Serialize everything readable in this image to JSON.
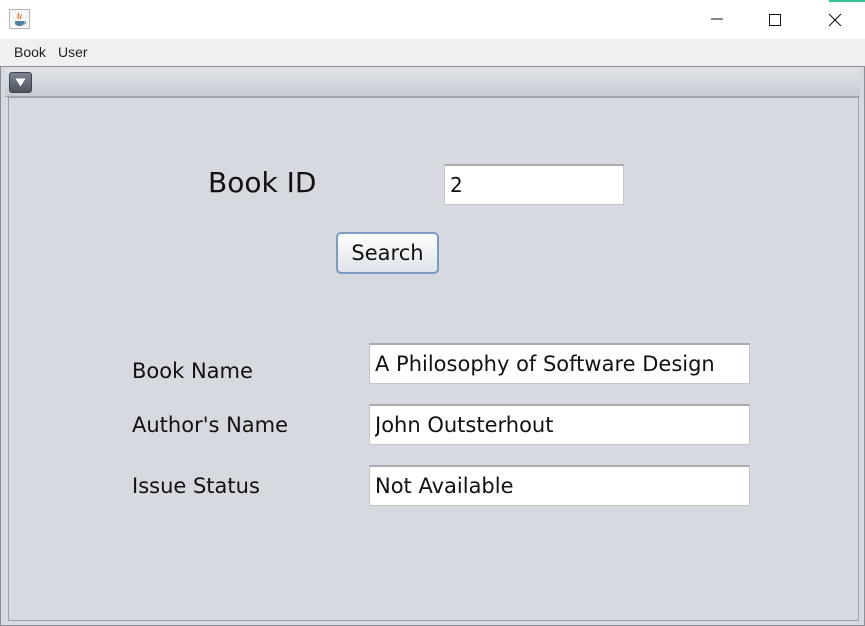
{
  "window": {
    "minimize_symbol": "",
    "maximize_symbol": "",
    "close_symbol": ""
  },
  "menubar": {
    "items": [
      {
        "label": "Book"
      },
      {
        "label": "User"
      }
    ]
  },
  "form": {
    "book_id_label": "Book ID",
    "book_id_value": "2",
    "search_label": "Search",
    "book_name_label": "Book Name",
    "book_name_value": "A Philosophy of Software Design",
    "author_label": "Author's Name",
    "author_value": "John Outsterhout",
    "status_label": "Issue Status",
    "status_value": "Not Available"
  },
  "icons": {
    "app": "java-app-icon",
    "minimize": "minimize-icon",
    "maximize": "maximize-icon",
    "close": "close-icon",
    "system_menu": "dropdown-triangle-icon"
  },
  "colors": {
    "panel_background": "#d6d9df",
    "button_border": "#7d9bc0"
  }
}
